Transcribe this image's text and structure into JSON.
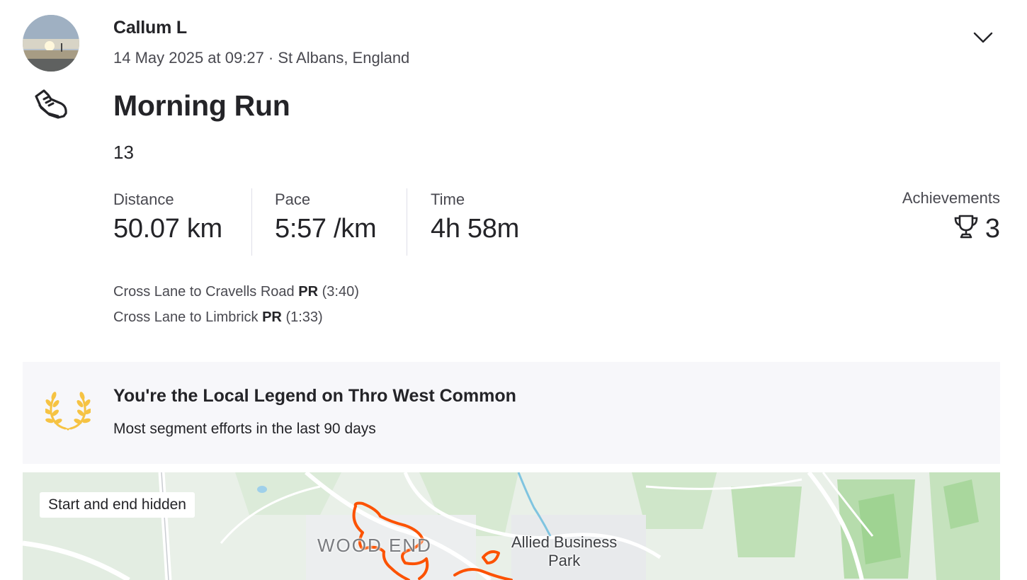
{
  "athlete": {
    "name": "Callum L",
    "avatar_icon": "avatar-photo"
  },
  "activity": {
    "meta": "14 May 2025 at 09:27 · St Albans, England",
    "sport_icon": "running-shoe-icon",
    "title": "Morning Run",
    "description": "13"
  },
  "stats": [
    {
      "label": "Distance",
      "value": "50.07 km"
    },
    {
      "label": "Pace",
      "value": "5:57 /km"
    },
    {
      "label": "Time",
      "value": "4h 58m"
    }
  ],
  "achievements": {
    "label": "Achievements",
    "count": "3",
    "icon": "trophy-icon"
  },
  "segments": [
    {
      "name": "Cross Lane to Cravells Road",
      "badge": "PR",
      "time": "(3:40)"
    },
    {
      "name": "Cross Lane to Limbrick",
      "badge": "PR",
      "time": "(1:33)"
    }
  ],
  "local_legend": {
    "icon": "laurel-icon",
    "title": "You're the Local Legend on Thro West Common",
    "subtitle": "Most segment efforts in the last 90 days"
  },
  "map": {
    "badge": "Start and end hidden",
    "place_label_1": "WOOD END",
    "place_label_2_line1": "Allied Business",
    "place_label_2_line2": "Park",
    "route_color": "#fc5200"
  },
  "colors": {
    "text_primary": "#242428",
    "text_secondary": "#494950",
    "laurel": "#f6c343",
    "card_bg": "#f7f7fa"
  }
}
